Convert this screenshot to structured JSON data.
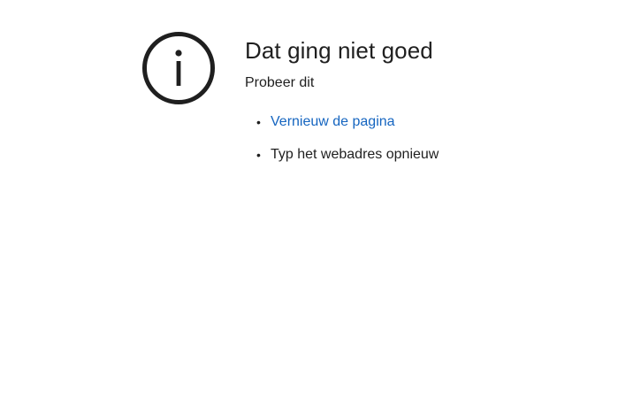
{
  "error": {
    "icon": "info-icon",
    "title": "Dat ging niet goed",
    "subtitle": "Probeer dit",
    "suggestions": [
      {
        "label": "Vernieuw de pagina",
        "type": "link"
      },
      {
        "label": "Typ het webadres opnieuw",
        "type": "text"
      }
    ]
  },
  "colors": {
    "text": "#1f1f1f",
    "link": "#1565c0",
    "icon": "#1f1f1f",
    "background": "#ffffff"
  }
}
